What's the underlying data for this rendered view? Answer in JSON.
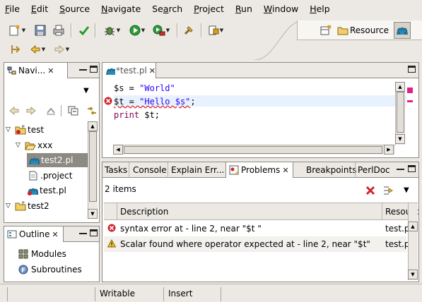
{
  "menu": [
    "File",
    "Edit",
    "Source",
    "Navigate",
    "Search",
    "Project",
    "Run",
    "Window",
    "Help"
  ],
  "menu_mnemonics": [
    "F",
    "E",
    "S",
    "N",
    "a",
    "P",
    "R",
    "W",
    "H"
  ],
  "perspective": {
    "label": "Resource"
  },
  "navigator": {
    "tab_label": "Navi...",
    "tree": [
      {
        "label": "test"
      },
      {
        "label": "xxx"
      },
      {
        "label": "test2.pl"
      },
      {
        "label": ".project"
      },
      {
        "label": "test.pl"
      },
      {
        "label": "test2"
      }
    ]
  },
  "outline": {
    "tab_label": "Outline",
    "items": [
      "Modules",
      "Subroutines"
    ]
  },
  "editor": {
    "tab_label": "*test.pl",
    "lines": [
      [
        "$s",
        " = ",
        "\"World\""
      ],
      [
        "$t",
        " = ",
        "\"Hello $s\"",
        ";"
      ],
      [
        "print",
        " $t;"
      ]
    ]
  },
  "bottom_tabs": {
    "tasks": "Tasks",
    "console": "Console",
    "explain": "Explain Err...",
    "problems": "Problems",
    "breakpoints": "Breakpoints",
    "perldoc": "PerlDoc"
  },
  "problems": {
    "count_label": "2 items",
    "columns": [
      "Description",
      "Resourc"
    ],
    "rows": [
      {
        "severity": "error",
        "description": "syntax error at - line 2, near \"$t \"",
        "resource": "test.pl"
      },
      {
        "severity": "warning",
        "description": "Scalar found where operator expected at - line 2, near \"$t\"",
        "resource": "test.pl"
      }
    ]
  },
  "status": {
    "writable": "Writable",
    "insert": "Insert"
  },
  "colors": {
    "chrome": "#ece9e4",
    "border": "#8e8a83",
    "error": "#d0242a",
    "warning": "#f5c518",
    "selection": "#8d8a84",
    "current_line": "#e8f2fe",
    "keyword": "#7f0055",
    "string": "#2a00ff"
  }
}
